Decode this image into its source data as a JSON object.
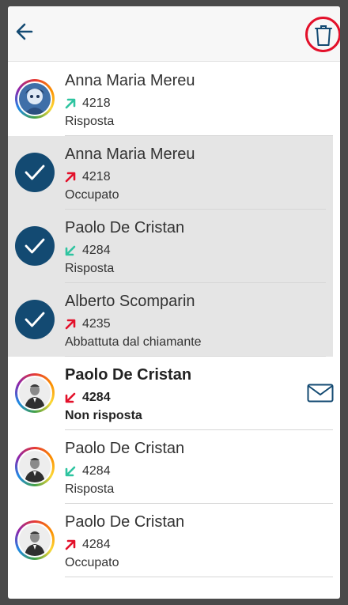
{
  "header": {
    "back_icon": "arrow-left-icon",
    "delete_icon": "trash-icon"
  },
  "colors": {
    "accent": "#134a72",
    "outgoing_answered": "#2ec4a0",
    "incoming_answered": "#2ec4a0",
    "outgoing_failed": "#e3102a",
    "missed": "#e3102a",
    "highlight_ring": "#e3102a"
  },
  "calls": [
    {
      "name": "Anna Maria Mereu",
      "number": "4218",
      "status": "Risposta",
      "direction": "outgoing",
      "arrow_color": "#2ec4a0",
      "selected": false,
      "unread": false
    },
    {
      "name": "Anna Maria Mereu",
      "number": "4218",
      "status": "Occupato",
      "direction": "outgoing",
      "arrow_color": "#e3102a",
      "selected": true,
      "unread": false
    },
    {
      "name": "Paolo De Cristan",
      "number": "4284",
      "status": "Risposta",
      "direction": "incoming",
      "arrow_color": "#2ec4a0",
      "selected": true,
      "unread": false
    },
    {
      "name": "Alberto Scomparin",
      "number": "4235",
      "status": "Abbattuta dal chiamante",
      "direction": "outgoing",
      "arrow_color": "#e3102a",
      "selected": true,
      "unread": false
    },
    {
      "name": "Paolo De Cristan",
      "number": "4284",
      "status": "Non risposta",
      "direction": "incoming",
      "arrow_color": "#e3102a",
      "selected": false,
      "unread": true,
      "mail_icon": "mail-icon"
    },
    {
      "name": "Paolo De Cristan",
      "number": "4284",
      "status": "Risposta",
      "direction": "incoming",
      "arrow_color": "#2ec4a0",
      "selected": false,
      "unread": false
    },
    {
      "name": "Paolo De Cristan",
      "number": "4284",
      "status": "Occupato",
      "direction": "outgoing",
      "arrow_color": "#e3102a",
      "selected": false,
      "unread": false
    }
  ]
}
